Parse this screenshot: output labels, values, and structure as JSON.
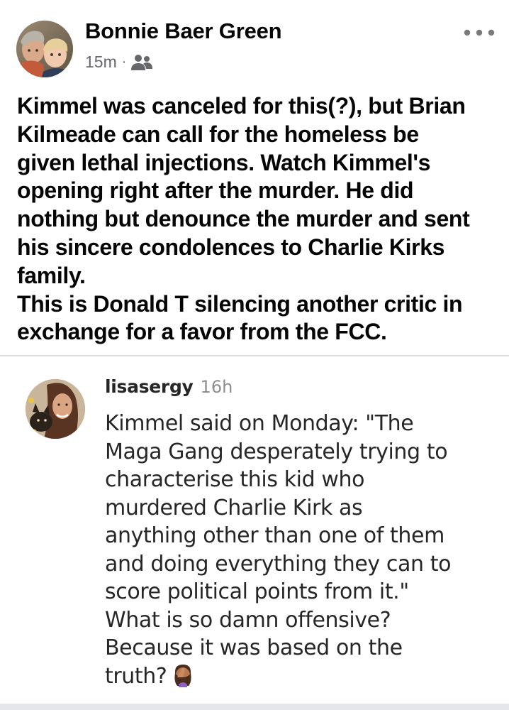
{
  "post": {
    "author_name": "Bonnie Baer Green",
    "timestamp": "15m",
    "separator": "·",
    "audience_icon": "friends-icon",
    "more_icon": "more-options-icon",
    "text_lines": [
      "Kimmel was canceled for this(?),  but Brian",
      "Kilmeade can call for the homeless be",
      "given lethal injections. Watch Kimmel's",
      "opening right after the murder. He did",
      "nothing but denounce the murder and sent",
      "his sincere condolences to Charlie Kirks",
      "family.",
      "This is Donald T  silencing another critic in",
      "exchange for a favor from the FCC."
    ]
  },
  "comment": {
    "username": "lisasergy",
    "timestamp": "16h",
    "text_lines": [
      "Kimmel said on Monday: \"The",
      "Maga Gang desperately trying to",
      "characterise this kid who",
      "murdered Charlie Kirk as",
      "anything other than one of them",
      "and doing everything they can to",
      "score political points from it.\"",
      "What is so damn offensive?",
      "Because it was based on the",
      "truth?"
    ],
    "trailing_emoji": "facepalm-emoji"
  },
  "colors": {
    "text_primary": "#050505",
    "text_secondary": "#65676b",
    "comment_text": "#262626",
    "comment_time": "#8e8e8e",
    "divider": "#dcdcdc"
  }
}
